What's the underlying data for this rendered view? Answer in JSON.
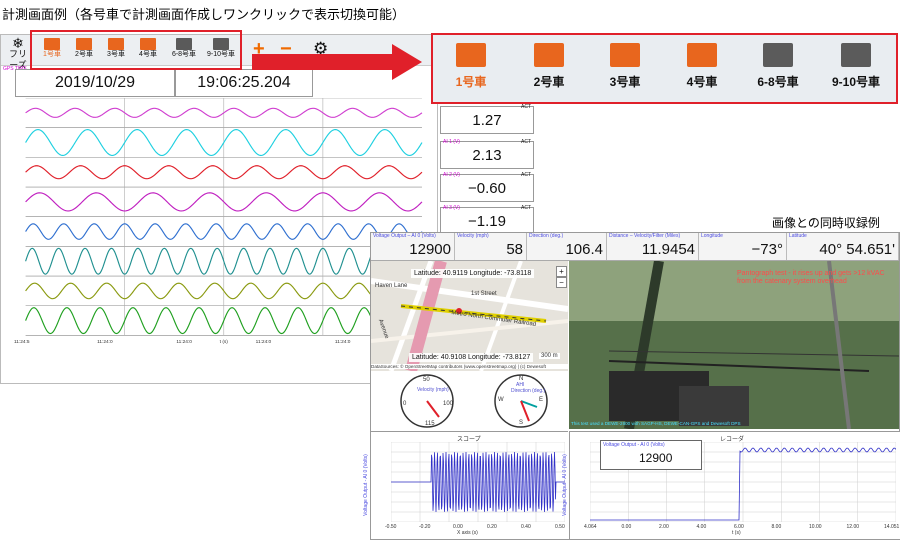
{
  "captions": {
    "top": "計測画面例（各号車で計測画面作成しワンクリックで表示切換可能）",
    "recording": "画像との同時収録例"
  },
  "toolbar": {
    "freeze_label": "フリーズ",
    "cars": [
      {
        "label": "1号車",
        "active": true,
        "icon": "waveform-icon"
      },
      {
        "label": "2号車",
        "active": false,
        "icon": "waveform-icon"
      },
      {
        "label": "3号車",
        "active": false,
        "icon": "waveform-icon"
      },
      {
        "label": "4号車",
        "active": false,
        "icon": "waveform-icon"
      },
      {
        "label": "6-8号車",
        "active": false,
        "icon": "sine-wave-icon"
      },
      {
        "label": "9-10号車",
        "active": false,
        "icon": "sine-wave-icon"
      }
    ],
    "plus": "+",
    "minus": "−",
    "active_color": "#e8661e"
  },
  "datetime": {
    "date": "2019/10/29",
    "time": "19:06:25.204"
  },
  "readouts": [
    {
      "label": "",
      "value": "1.27",
      "act": "ACT"
    },
    {
      "label": "AI 1 (V)",
      "value": "2.13",
      "act": "ACT"
    },
    {
      "label": "AI 2 (V)",
      "value": "−0.60",
      "act": "ACT"
    },
    {
      "label": "AI 3 (V)",
      "value": "−1.19",
      "act": "ACT"
    }
  ],
  "plot": {
    "time_start": "11:24:5",
    "time_end": "11:24:5",
    "x_ticks": [
      "11:24:0",
      "11:24:0",
      "11:24:0",
      "11:24:0"
    ],
    "x_unit": "t (s)",
    "channels": [
      {
        "color": "#d040d0",
        "amp": 0.35,
        "cycles": 10
      },
      {
        "color": "#1fd0e0",
        "amp": 1.0,
        "cycles": 8
      },
      {
        "color": "#e0202a",
        "amp": 0.5,
        "cycles": 9
      },
      {
        "color": "#c020c0",
        "amp": 0.7,
        "cycles": 7
      },
      {
        "color": "#3070d0",
        "amp": 0.6,
        "cycles": 13
      },
      {
        "color": "#209090",
        "amp": 1.0,
        "cycles": 15
      },
      {
        "color": "#8a9a10",
        "amp": 0.6,
        "cycles": 11
      },
      {
        "color": "#20a020",
        "amp": 1.0,
        "cycles": 12
      }
    ]
  },
  "recording": {
    "metrics": [
      {
        "tag": "Voltage Output – AI 0 (Volts)",
        "value": "12900"
      },
      {
        "tag": "Velocity (mph)",
        "value": "58"
      },
      {
        "tag": "Direction (deg.)",
        "value": "106.4"
      },
      {
        "tag": "Distance – Velocity/Filter (Miles)",
        "value": "11.9454"
      },
      {
        "tag": "Longitude",
        "value": "−73°  48.763'"
      },
      {
        "tag": "Latitude",
        "value": "40°  54.651'"
      }
    ],
    "map": {
      "lat_top": "Latitude: 40.9119  Longitude: -73.8118",
      "lat_bottom": "Latitude: 40.9108  Longitude: -73.8127",
      "scale": "300 m",
      "credit": "DataSources: © OpenStreetMap contributors (www.openstreetmap.org) | (c) Dewesoft",
      "street1": "Metro North Commuter Railroad",
      "street2": "1st Street",
      "street3": "Haven Lane",
      "street4": "Avenue"
    },
    "gauges": [
      {
        "title": "Velocity (mph)",
        "ticks": [
          "0",
          "50",
          "100",
          "115"
        ]
      },
      {
        "title": "Direction (deg.)",
        "ticks": [
          "N",
          "E",
          "S",
          "W"
        ],
        "sub": "AHI"
      }
    ],
    "video_text": "Pantograph test - it rises up and gets >12 kVAC from the catenary system overhead",
    "video_footer": "This test used a DEWE-2600 with SAGP-HS, DEWE-CAN-GPS and Dewesoft DPS",
    "scope": {
      "title": "スコープ",
      "ylabel": "Voltage Output - AI 0 (Volts)",
      "x_ticks": [
        "-0.50",
        "-0.20",
        "0.00",
        "0.20",
        "0.40",
        "0.50"
      ],
      "xlabel": "X axis (s)"
    },
    "recorder": {
      "title": "レコーダ",
      "channel": "Voltage Output - AI 0 (Volts)",
      "value": "12900",
      "ylabel": "Voltage Output - AI 0 (Volts)",
      "x_ticks": [
        "4.064",
        "0.00",
        "2.00",
        "4.00",
        "6.00",
        "8.00",
        "10.00",
        "12.00",
        "14.051"
      ],
      "xlabel": "t (s)"
    }
  }
}
